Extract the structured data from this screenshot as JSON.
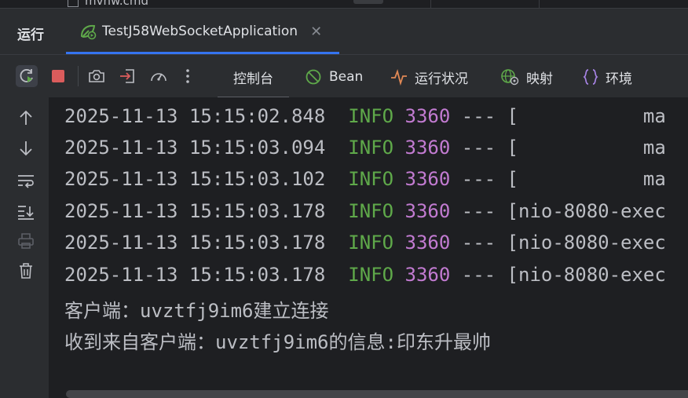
{
  "top_strip": {
    "file_name": "mvnw.cmd"
  },
  "run_panel": {
    "title": "运行",
    "tab": {
      "label": "TestJ58WebSocketApplication",
      "close": "✕"
    }
  },
  "toolbar": {
    "buttons": [
      {
        "name": "rerun",
        "icon": "rerun-icon"
      },
      {
        "name": "stop",
        "icon": "stop-icon"
      },
      {
        "name": "screenshot",
        "icon": "camera-icon"
      },
      {
        "name": "attach",
        "icon": "import-icon"
      },
      {
        "name": "profiler",
        "icon": "speedometer-icon"
      },
      {
        "name": "more",
        "icon": "more-vertical-icon"
      }
    ],
    "tabs": [
      {
        "label": "控制台",
        "icon": ""
      },
      {
        "label": "Bean",
        "icon": "bean-icon"
      },
      {
        "label": "运行状况",
        "icon": "pulse-icon"
      },
      {
        "label": "映射",
        "icon": "globe-icon"
      },
      {
        "label": "环境",
        "icon": "braces-icon"
      }
    ]
  },
  "gutter": {
    "icons": [
      "up-arrow-icon",
      "down-arrow-icon",
      "soft-wrap-icon",
      "scroll-to-end-icon",
      "print-icon",
      "trash-icon"
    ]
  },
  "console": {
    "log_lines": [
      {
        "timestamp": "2025-11-13 15:15:02.848",
        "level": "INFO",
        "pid": "3360",
        "rest": " --- [           ma"
      },
      {
        "timestamp": "2025-11-13 15:15:03.094",
        "level": "INFO",
        "pid": "3360",
        "rest": " --- [           ma"
      },
      {
        "timestamp": "2025-11-13 15:15:03.102",
        "level": "INFO",
        "pid": "3360",
        "rest": " --- [           ma"
      },
      {
        "timestamp": "2025-11-13 15:15:03.178",
        "level": "INFO",
        "pid": "3360",
        "rest": " --- [nio-8080-exec"
      },
      {
        "timestamp": "2025-11-13 15:15:03.178",
        "level": "INFO",
        "pid": "3360",
        "rest": " --- [nio-8080-exec"
      },
      {
        "timestamp": "2025-11-13 15:15:03.178",
        "level": "INFO",
        "pid": "3360",
        "rest": " --- [nio-8080-exec"
      }
    ],
    "messages": [
      "客户端：uvztfj9im6建立连接",
      "收到来自客户端：uvztfj9im6的信息:印东升最帅"
    ]
  },
  "colors": {
    "background": "#1e1f22",
    "panel": "#2b2d30",
    "info_level": "#5fa94a",
    "pid": "#c27bd1",
    "accent": "#3574f0",
    "stop_red": "#db5c5c"
  }
}
